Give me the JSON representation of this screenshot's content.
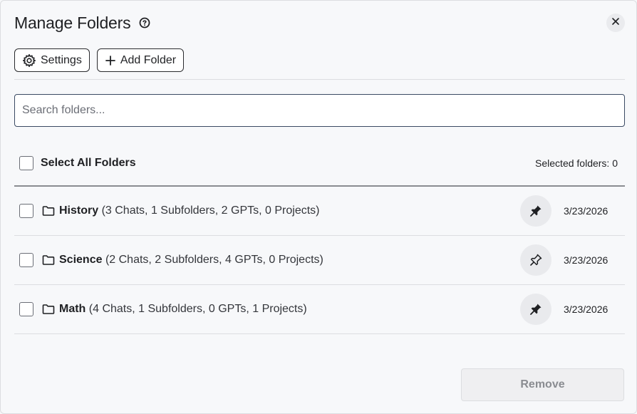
{
  "dialog": {
    "title": "Manage Folders",
    "help_icon": "help-circle-icon",
    "close_icon": "close-icon"
  },
  "toolbar": {
    "settings_label": "Settings",
    "settings_icon": "gear-icon",
    "add_folder_label": "Add Folder",
    "add_folder_icon": "plus-icon"
  },
  "search": {
    "placeholder": "Search folders...",
    "value": ""
  },
  "selection": {
    "select_all_label": "Select All Folders",
    "select_all_checked": false,
    "selected_count_text": "Selected folders: 0"
  },
  "folders": [
    {
      "name": "History",
      "details": "(3 Chats, 1 Subfolders, 2 GPTs, 0 Projects)",
      "date": "3/23/2026",
      "pinned": true,
      "checked": false
    },
    {
      "name": "Science",
      "details": "(2 Chats, 2 Subfolders, 4 GPTs, 0 Projects)",
      "date": "3/23/2026",
      "pinned": false,
      "checked": false
    },
    {
      "name": "Math",
      "details": "(4 Chats, 1 Subfolders, 0 GPTs, 1 Projects)",
      "date": "3/23/2026",
      "pinned": true,
      "checked": false
    }
  ],
  "footer": {
    "remove_label": "Remove",
    "remove_disabled": true
  },
  "colors": {
    "background": "#f7f8fa",
    "text": "#1f2023",
    "input_border": "#3b4a63",
    "disabled_text": "#8a8c91"
  }
}
